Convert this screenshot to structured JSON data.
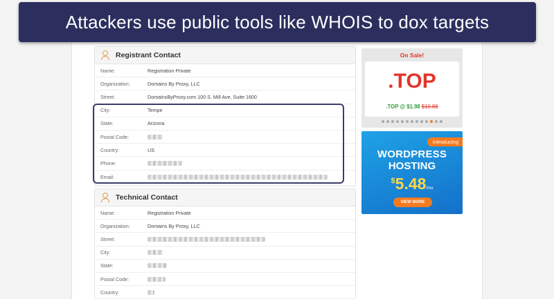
{
  "banner": {
    "title": "Attackers use public tools like WHOIS to dox targets"
  },
  "registrant": {
    "title": "Registrant Contact",
    "rows": [
      {
        "label": "Name:",
        "value": "Registration Private"
      },
      {
        "label": "Organization:",
        "value": "Domains By Proxy, LLC"
      },
      {
        "label": "Street:",
        "value": "DomainsByProxy.com 100 S. Mill Ave, Suite 1600"
      },
      {
        "label": "City:",
        "value": "Tempe"
      },
      {
        "label": "State:",
        "value": "Arizona"
      },
      {
        "label": "Postal Code:",
        "value": ""
      },
      {
        "label": "Country:",
        "value": "US"
      },
      {
        "label": "Phone:",
        "value": ""
      },
      {
        "label": "Email:",
        "value": ""
      }
    ]
  },
  "technical": {
    "title": "Technical Contact",
    "rows": [
      {
        "label": "Name:",
        "value": "Registration Private"
      },
      {
        "label": "Organization:",
        "value": "Domains By Proxy, LLC"
      },
      {
        "label": "Street:",
        "value": ""
      },
      {
        "label": "City:",
        "value": ""
      },
      {
        "label": "State:",
        "value": ""
      },
      {
        "label": "Postal Code:",
        "value": ""
      },
      {
        "label": "Country:",
        "value": ""
      }
    ]
  },
  "ads": {
    "sale": {
      "tag": "On Sale!",
      "tld": ".TOP",
      "price": ".TOP @ $1.98",
      "old_price": "$10.88"
    },
    "wordpress": {
      "intro": "Introducing",
      "line1": "WORDPRESS",
      "line2": "HOSTING",
      "currency": "$",
      "price": "5.48",
      "per": "/mo",
      "button": "VIEW MORE"
    }
  },
  "colors": {
    "banner": "#2c2f5e",
    "accent": "#f47a20",
    "sale_red": "#e2362a",
    "wp_blue": "#1470c9"
  }
}
